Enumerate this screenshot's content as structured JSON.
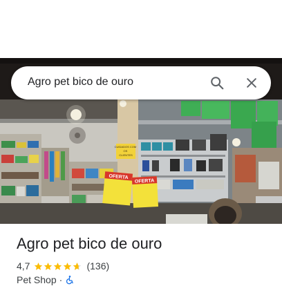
{
  "search": {
    "query": "Agro pet bico de ouro",
    "search_icon": "search-icon",
    "close_icon": "close-icon"
  },
  "photo": {
    "sign_offer_1": "OFERTA",
    "sign_offer_2": "OFERTA",
    "sign_notice": "CUIDADOS COM OS CLIENTES"
  },
  "place": {
    "name": "Agro pet bico de ouro",
    "rating": "4,7",
    "stars": 4.7,
    "review_count": "(136)",
    "category": "Pet Shop",
    "separator": "·",
    "accessibility_icon": "wheelchair-icon"
  },
  "colors": {
    "star": "#fbbc04",
    "accessibility": "#1a73e8",
    "text_primary": "#202124",
    "text_secondary": "#3c4043"
  }
}
